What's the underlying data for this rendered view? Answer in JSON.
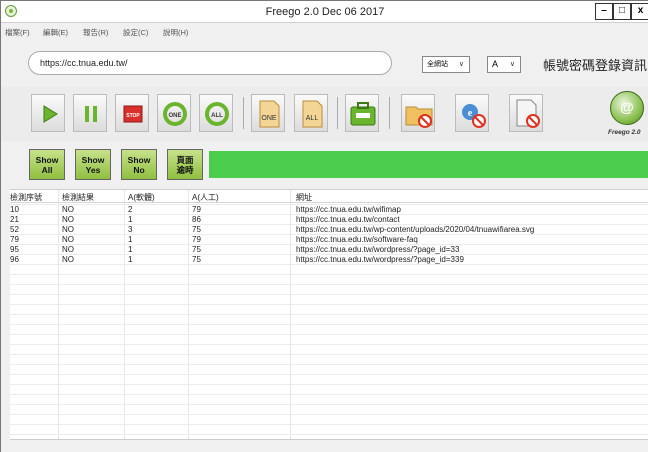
{
  "window": {
    "title": "Freego 2.0 Dec 06 2017",
    "controls": {
      "minimize": "–",
      "maximize": "□",
      "close": "x"
    }
  },
  "menu": [
    {
      "label": "檔案(F)"
    },
    {
      "label": "編輯(E)"
    },
    {
      "label": "報告(R)"
    },
    {
      "label": "設定(C)"
    },
    {
      "label": "說明(H)"
    }
  ],
  "url_bar": {
    "value": "https://cc.tnua.edu.tw/",
    "scope_select": "全網站",
    "charset_select": "A",
    "right_title": "帳號密碼登錄資訊"
  },
  "toolbar": {
    "one_label": "ONE",
    "all_label": "ALL",
    "stop_label": "STOP",
    "colors": {
      "play": "#6bb52e",
      "stop": "#d9302c",
      "folder": "#f0c060",
      "block": "#e03020"
    }
  },
  "logo": {
    "text": "Freego 2.0",
    "symbol": "@"
  },
  "show_buttons": [
    {
      "line1": "Show",
      "line2": "All"
    },
    {
      "line1": "Show",
      "line2": "Yes"
    },
    {
      "line1": "Show",
      "line2": "No"
    },
    {
      "line1": "頁面",
      "line2": "逾時"
    }
  ],
  "progress": {
    "fraction": 1.0,
    "color": "#4ccd4c"
  },
  "table": {
    "headers": [
      "檢測序號",
      "檢測結果",
      "A(軟體)",
      "A(人工)",
      "網址"
    ],
    "rows": [
      [
        "10",
        "NO",
        "2",
        "79",
        "https://cc.tnua.edu.tw/wifimap"
      ],
      [
        "21",
        "NO",
        "1",
        "86",
        "https://cc.tnua.edu.tw/contact"
      ],
      [
        "52",
        "NO",
        "3",
        "75",
        "https://cc.tnua.edu.tw/wp-content/uploads/2020/04/tnuawifiarea.svg"
      ],
      [
        "79",
        "NO",
        "1",
        "79",
        "https://cc.tnua.edu.tw/software-faq"
      ],
      [
        "95",
        "NO",
        "1",
        "75",
        "https://cc.tnua.edu.tw/wordpress/?page_id=33"
      ],
      [
        "96",
        "NO",
        "1",
        "75",
        "https://cc.tnua.edu.tw/wordpress/?page_id=339"
      ]
    ]
  }
}
